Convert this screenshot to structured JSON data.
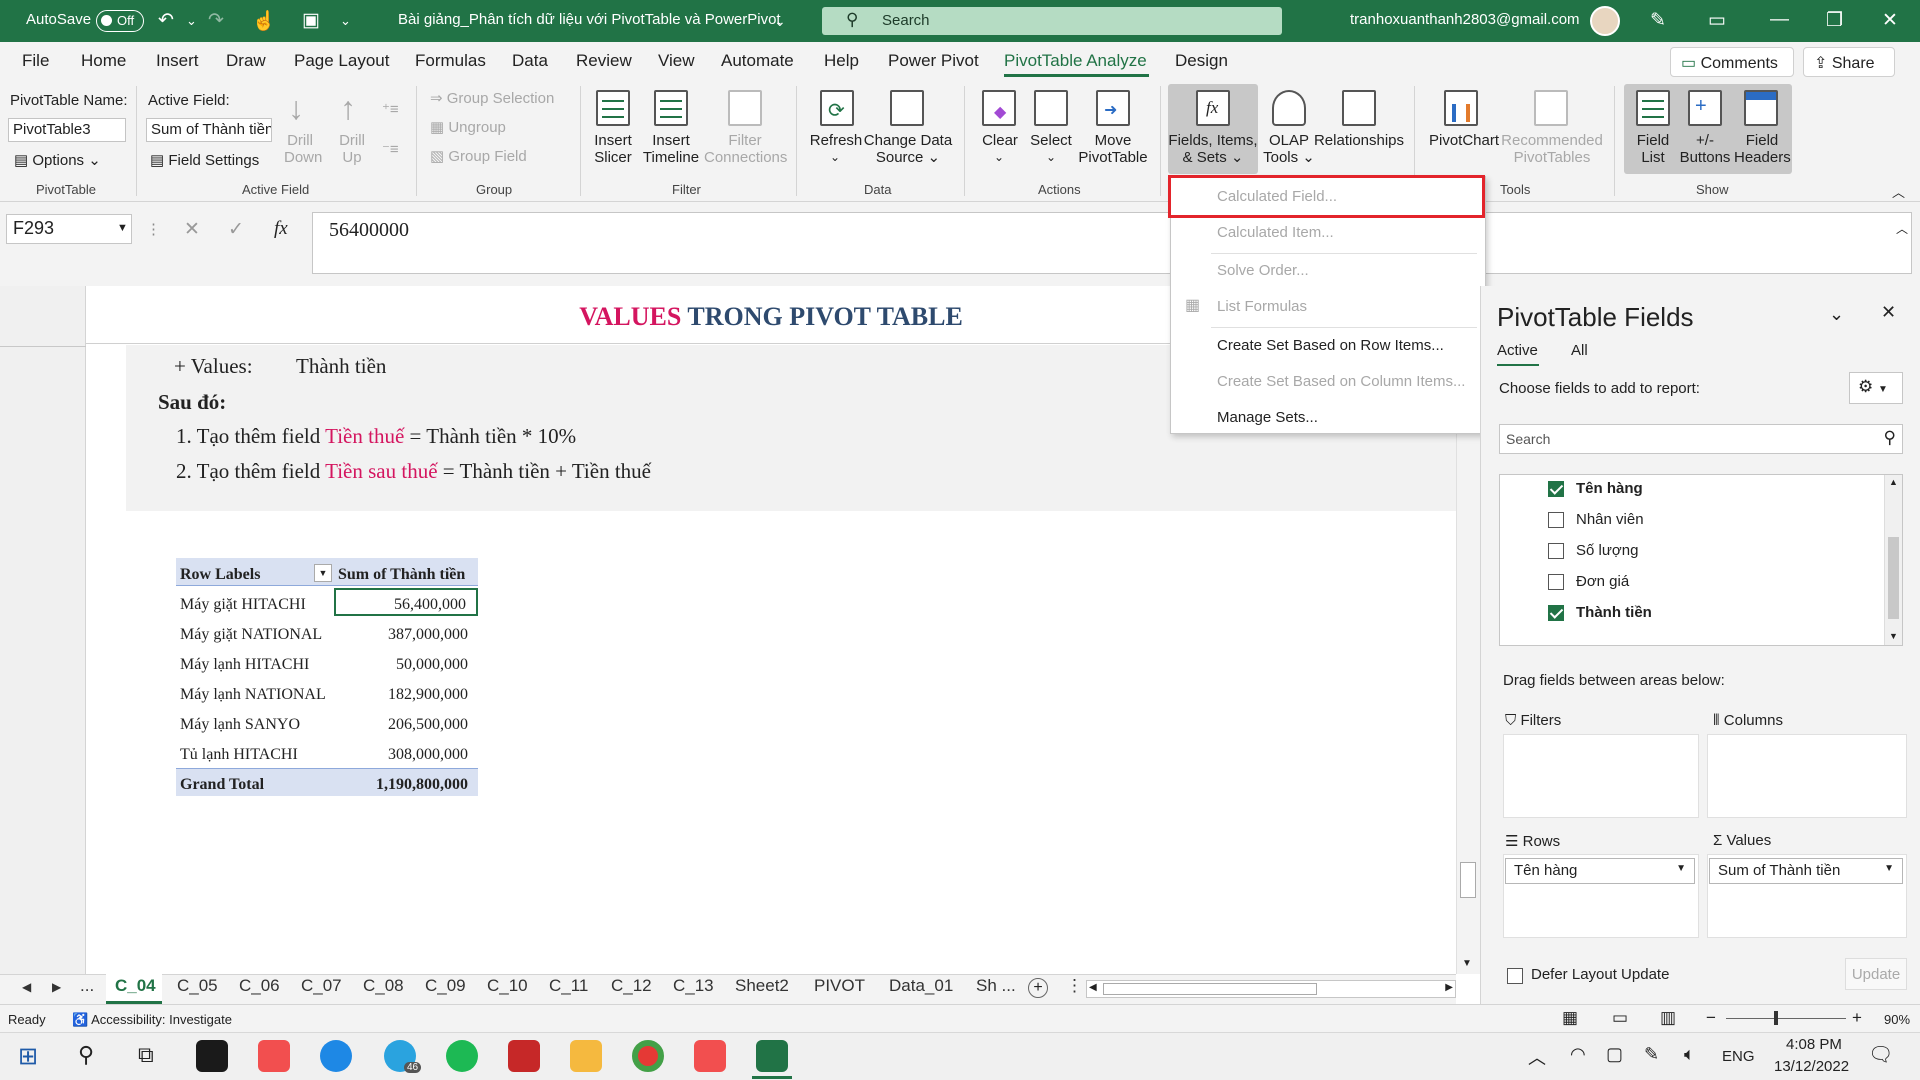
{
  "titlebar": {
    "autosave_label": "AutoSave",
    "autosave_state": "Off",
    "filename": "Bài giảng_Phân tích dữ liệu với PivotTable và PowerPivot",
    "search_placeholder": "Search",
    "user_email": "tranhoxuanthanh2803@gmail.com",
    "bg_color": "#217346"
  },
  "tabs": [
    "File",
    "Home",
    "Insert",
    "Draw",
    "Page Layout",
    "Formulas",
    "Data",
    "Review",
    "View",
    "Automate",
    "Help",
    "Power Pivot",
    "PivotTable Analyze",
    "Design"
  ],
  "active_tab": "PivotTable Analyze",
  "comments_label": "Comments",
  "share_label": "Share",
  "ribbon": {
    "pivottable": {
      "name_label": "PivotTable Name:",
      "name_value": "PivotTable3",
      "options": "Options",
      "group": "PivotTable"
    },
    "active_field": {
      "label": "Active Field:",
      "value": "Sum of Thành tiền",
      "settings": "Field Settings",
      "drill_down_1": "Drill",
      "drill_down_2": "Down",
      "drill_up_1": "Drill",
      "drill_up_2": "Up",
      "group": "Active Field"
    },
    "group": {
      "selection": "Group Selection",
      "ungroup": "Ungroup",
      "field": "Group Field",
      "group": "Group"
    },
    "filter": {
      "slicer_1": "Insert",
      "slicer_2": "Slicer",
      "timeline_1": "Insert",
      "timeline_2": "Timeline",
      "conn_1": "Filter",
      "conn_2": "Connections",
      "group": "Filter"
    },
    "data": {
      "refresh": "Refresh",
      "change_1": "Change Data",
      "change_2": "Source",
      "group": "Data"
    },
    "actions": {
      "clear": "Clear",
      "select": "Select",
      "move_1": "Move",
      "move_2": "PivotTable",
      "group": "Actions"
    },
    "calculations": {
      "fields_1": "Fields, Items,",
      "fields_2": "& Sets",
      "olap_1": "OLAP",
      "olap_2": "Tools",
      "relationships": "Relationships"
    },
    "tools": {
      "pivotchart": "PivotChart",
      "rec_1": "Recommended",
      "rec_2": "PivotTables",
      "group": "Tools"
    },
    "show": {
      "fieldlist_1": "Field",
      "fieldlist_2": "List",
      "buttons_1": "+/-",
      "buttons_2": "Buttons",
      "headers_1": "Field",
      "headers_2": "Headers",
      "group": "Show"
    }
  },
  "formula_bar": {
    "cell_ref": "F293",
    "fx": "fx",
    "value": "56400000"
  },
  "dropdown_menu": [
    {
      "label": "Calculated Field...",
      "disabled": true
    },
    {
      "label": "Calculated Item...",
      "disabled": true
    },
    {
      "label": "Solve Order...",
      "disabled": true
    },
    {
      "label": "List Formulas",
      "disabled": true
    },
    {
      "label": "Create Set Based on Row Items...",
      "disabled": false
    },
    {
      "label": "Create Set Based on Column Items...",
      "disabled": true
    },
    {
      "label": "Manage Sets...",
      "disabled": false
    }
  ],
  "sheet": {
    "banner_part1": "VALUES",
    "banner_part2": "TRONG PIVOT TABLE",
    "values_label": "+ Values:",
    "values_value": "Thành tiền",
    "then_label": "Sau đó:",
    "step1_prefix": "1. Tạo thêm field",
    "step1_field": "Tiền thuế",
    "step1_suffix": "= Thành tiền * 10%",
    "step2_prefix": "2. Tạo thêm field",
    "step2_field": "Tiền sau thuế",
    "step2_suffix": "= Thành tiền + Tiền thuế",
    "accent_color": "#d4155f"
  },
  "pivot_table": {
    "header_row_labels": "Row Labels",
    "header_sum": "Sum of Thành tiền",
    "rows": [
      {
        "label": "Máy giặt HITACHI",
        "value": "56,400,000"
      },
      {
        "label": "Máy giặt NATIONAL",
        "value": "387,000,000"
      },
      {
        "label": "Máy lạnh HITACHI",
        "value": "50,000,000"
      },
      {
        "label": "Máy lạnh NATIONAL",
        "value": "182,900,000"
      },
      {
        "label": "Máy lạnh SANYO",
        "value": "206,500,000"
      },
      {
        "label": "Tủ lạnh HITACHI",
        "value": "308,000,000"
      }
    ],
    "grand_total_label": "Grand Total",
    "grand_total_value": "1,190,800,000"
  },
  "pivot_pane": {
    "title": "PivotTable Fields",
    "tab_active": "Active",
    "tab_all": "All",
    "choose_label": "Choose fields to add to report:",
    "search_placeholder": "Search",
    "fields": [
      {
        "name": "Tên hàng",
        "checked": true
      },
      {
        "name": "Nhân viên",
        "checked": false
      },
      {
        "name": "Số lượng",
        "checked": false
      },
      {
        "name": "Đơn giá",
        "checked": false
      },
      {
        "name": "Thành tiền",
        "checked": true
      }
    ],
    "drag_label": "Drag fields between areas below:",
    "filters": "Filters",
    "columns": "Columns",
    "rows": "Rows",
    "values": "Values",
    "rows_item": "Tên hàng",
    "values_item": "Sum of Thành tiền",
    "defer_label": "Defer Layout Update",
    "update_label": "Update"
  },
  "sheet_tabs": [
    "C_04",
    "C_05",
    "C_06",
    "C_07",
    "C_08",
    "C_09",
    "C_10",
    "C_11",
    "C_12",
    "C_13",
    "Sheet2",
    "PIVOT",
    "Data_01",
    "Sh ..."
  ],
  "active_sheet": "C_04",
  "status": {
    "ready": "Ready",
    "accessibility": "Accessibility: Investigate",
    "zoom": "90%"
  },
  "taskbar": {
    "lang": "ENG",
    "time": "4:08 PM",
    "date": "13/12/2022",
    "telegram_badge": "46"
  }
}
